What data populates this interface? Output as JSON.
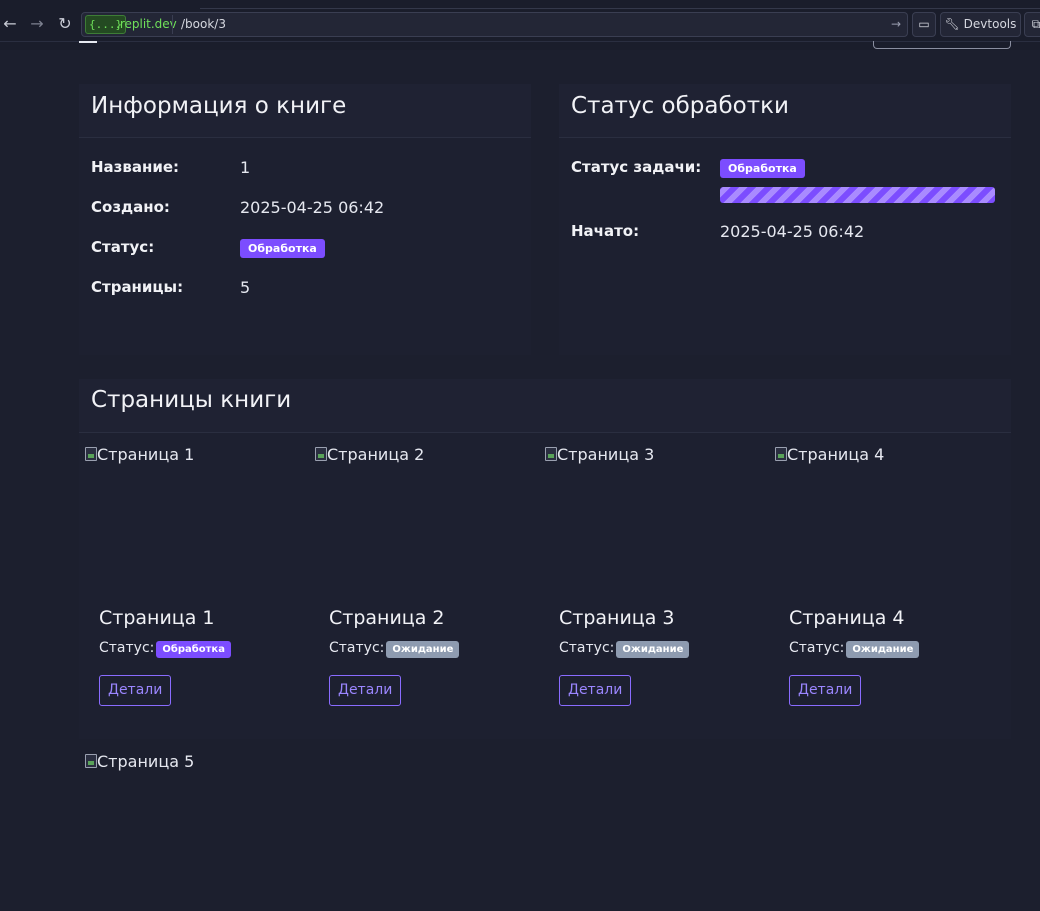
{
  "browser": {
    "back_icon": "←",
    "forward_icon": "→",
    "reload_icon": "↻",
    "url_badge": "{...}",
    "url_domain": ".replit.dev",
    "url_path": "/book/3",
    "go_icon": "→",
    "screen_icon": "▭",
    "devtools_label": "Devtools",
    "more_icon": "⧉"
  },
  "book_info": {
    "title": "Информация о книге",
    "rows": [
      {
        "label": "Название:",
        "value": "1"
      },
      {
        "label": "Создано:",
        "value": "2025-04-25 06:42"
      },
      {
        "label": "Статус:",
        "badge": "Обработка"
      },
      {
        "label": "Страницы:",
        "value": "5"
      }
    ]
  },
  "processing": {
    "title": "Статус обработки",
    "task_label": "Статус задачи:",
    "task_badge": "Обработка",
    "started_label": "Начато:",
    "started_value": "2025-04-25 06:42"
  },
  "pages_section": {
    "title": "Страницы книги",
    "status_prefix": "Статус:",
    "details_label": "Детали",
    "pages": [
      {
        "img_alt": "Страница 1",
        "title": "Страница 1",
        "status": "Обработка"
      },
      {
        "img_alt": "Страница 2",
        "title": "Страница 2",
        "status": "Ожидание"
      },
      {
        "img_alt": "Страница 3",
        "title": "Страница 3",
        "status": "Ожидание"
      },
      {
        "img_alt": "Страница 4",
        "title": "Страница 4",
        "status": "Ожидание"
      },
      {
        "img_alt": "Страница 5"
      }
    ]
  },
  "colors": {
    "background": "#1c1f2e",
    "accent": "#7c4dff",
    "waiting": "#8e9bb0",
    "domain_green": "#6fe05a"
  }
}
